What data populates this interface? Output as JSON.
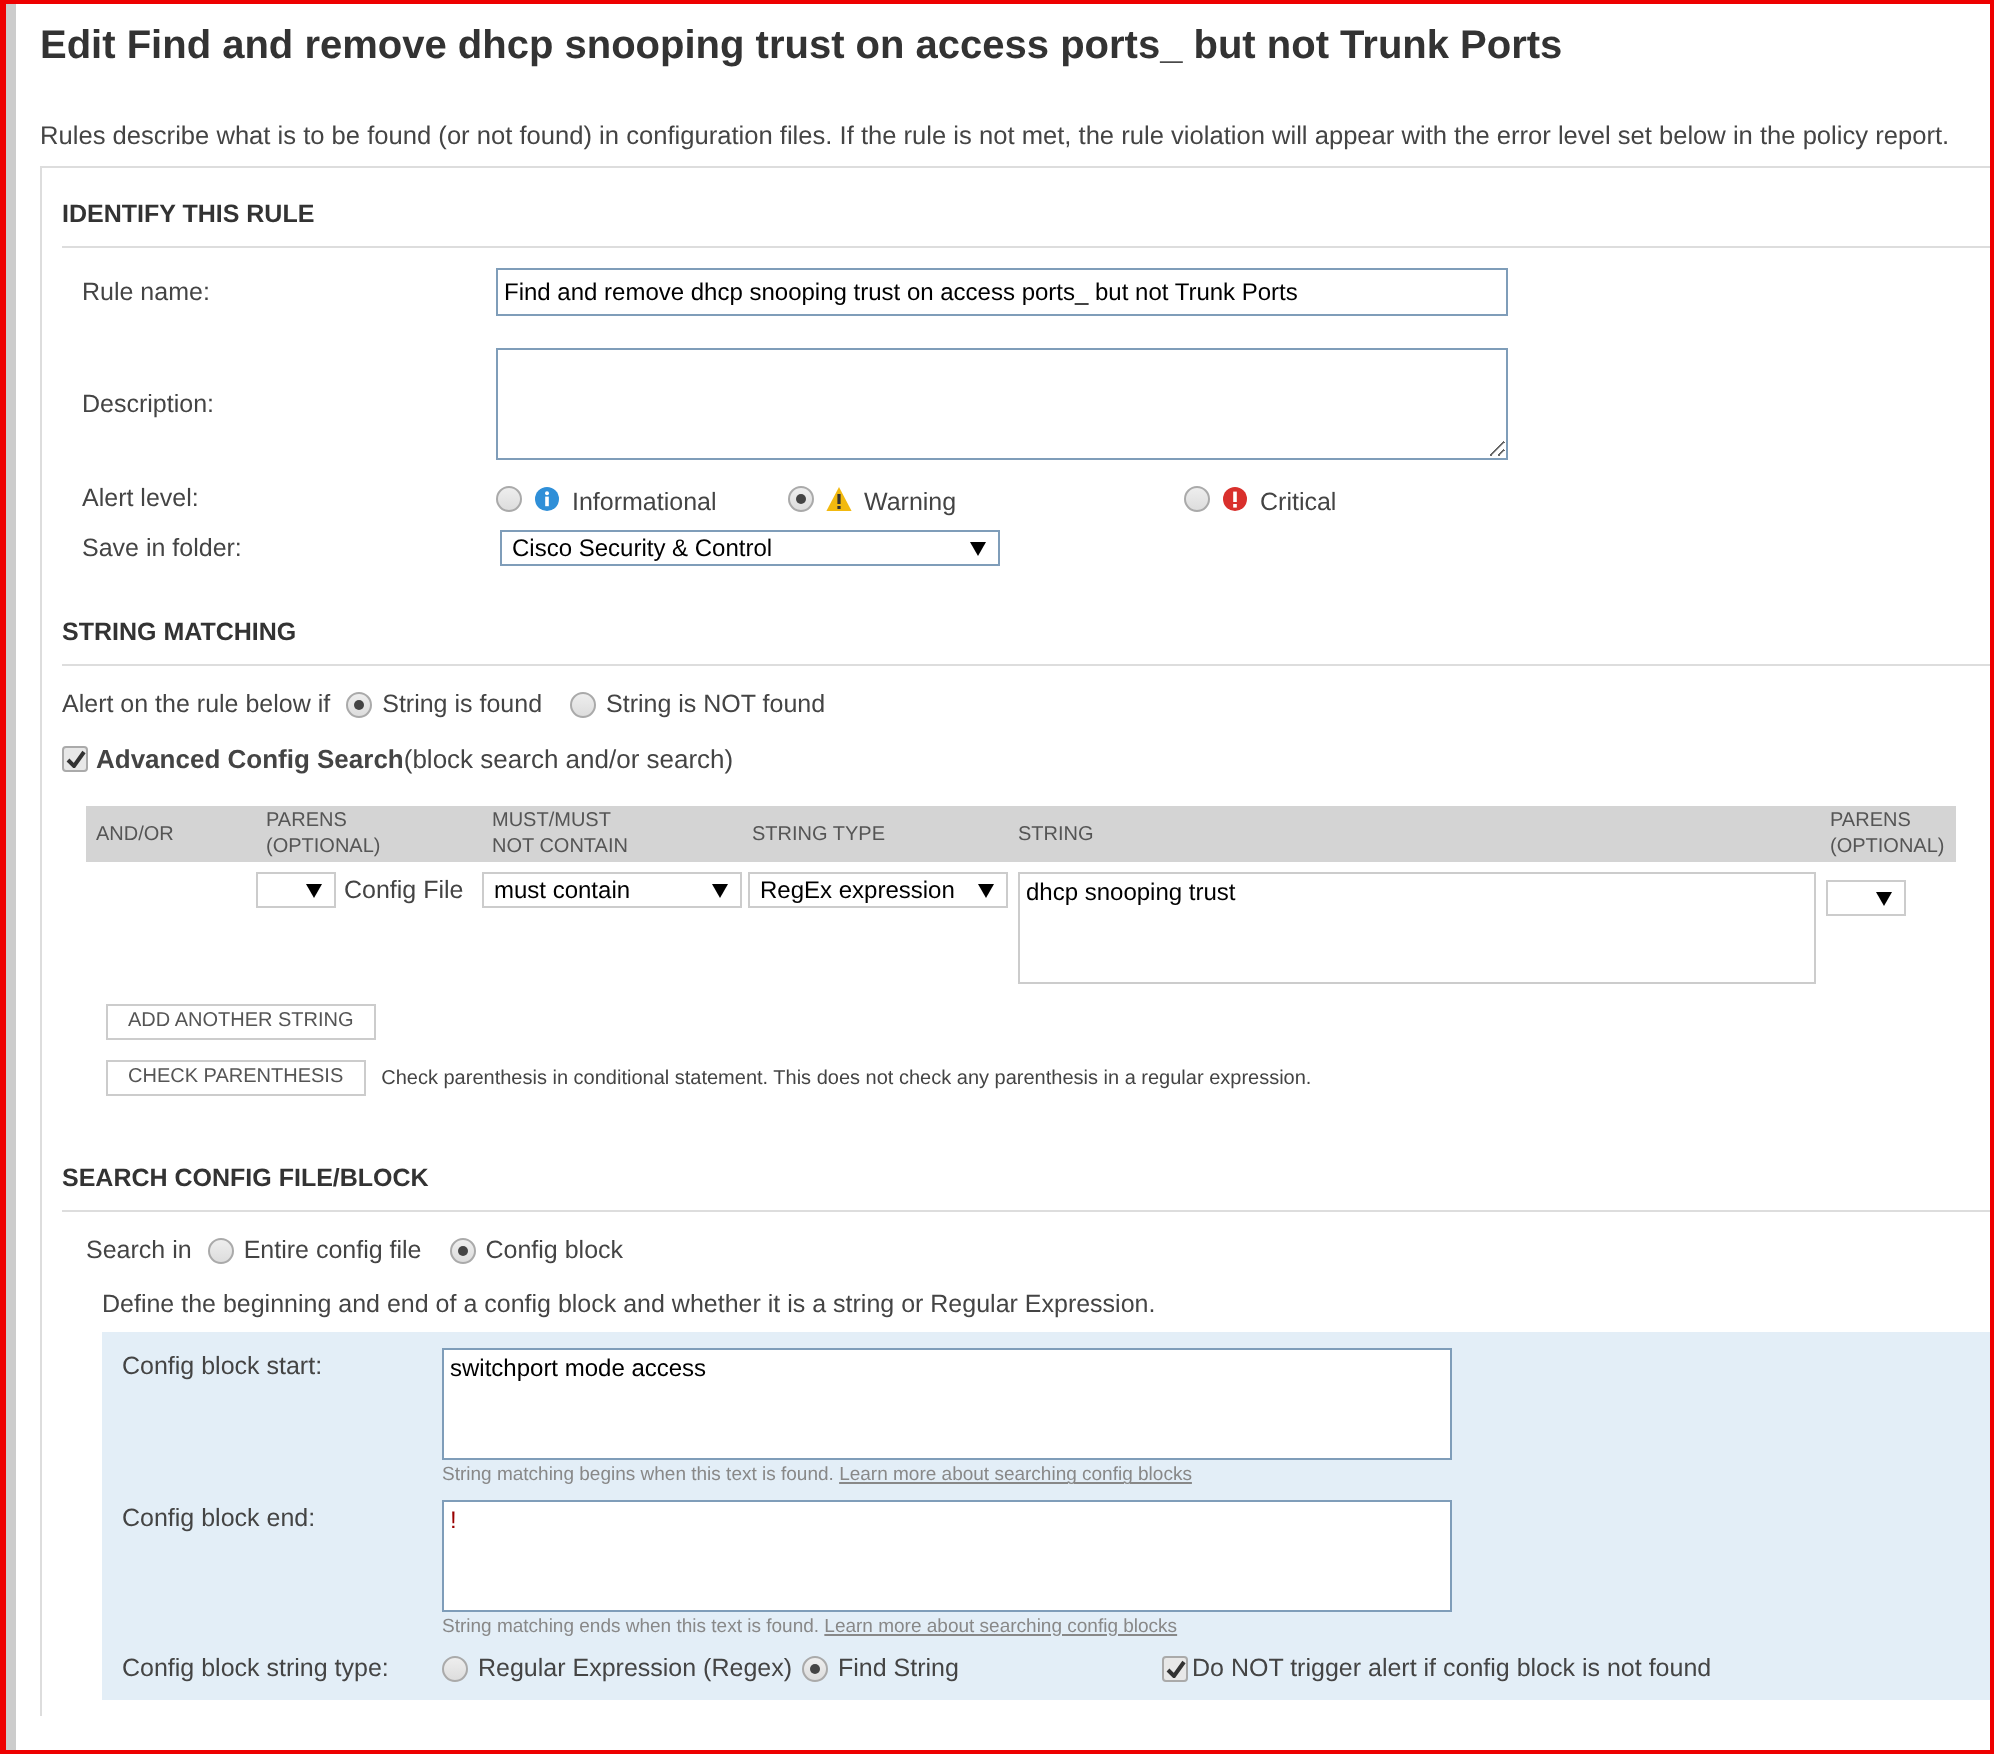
{
  "title": "Edit Find and remove dhcp snooping trust on access ports_ but not Trunk Ports",
  "intro": "Rules describe what is to be found (or not found) in configuration files. If the rule is not met, the rule violation will appear with the error level set below in the policy report.",
  "identify": {
    "heading": "IDENTIFY THIS RULE",
    "rule_name": {
      "label": "Rule name:",
      "value": "Find and remove dhcp snooping trust on access ports_ but not Trunk Ports"
    },
    "description": {
      "label": "Description:"
    },
    "alert_level": {
      "label": "Alert level:",
      "options": [
        {
          "label": "Informational",
          "kind": "info",
          "selected": false
        },
        {
          "label": "Warning",
          "kind": "warning",
          "selected": true
        },
        {
          "label": "Critical",
          "kind": "critical",
          "selected": false
        }
      ]
    },
    "folder": {
      "label": "Save in folder:",
      "value": "Cisco Security & Control"
    }
  },
  "string_matching": {
    "heading": "STRING MATCHING",
    "alert_on": {
      "label": "Alert on the rule below if",
      "options": [
        {
          "label": "String is found",
          "selected": true
        },
        {
          "label": "String is NOT found",
          "selected": false
        }
      ]
    },
    "advanced": {
      "checked": true,
      "label": "**Advanced Config Search**(block search and/or search)"
    },
    "table": {
      "columns": [
        "AND/OR",
        "PARENS (OPTIONAL)",
        "MUST/MUST NOT CONTAIN",
        "STRING TYPE",
        "STRING",
        "PARENS (OPTIONAL)"
      ],
      "rows": [
        {
          "source": "Config File",
          "must": "must contain",
          "string_type": "RegEx expression",
          "string": "dhcp snooping trust"
        }
      ]
    },
    "add_button": "ADD ANOTHER STRING",
    "check_button": "CHECK PARENTHESIS",
    "check_note": "Check parenthesis in conditional statement. This does not check any parenthesis in a regular expression."
  },
  "search_config": {
    "heading": "SEARCH CONFIG FILE/BLOCK",
    "search_in": {
      "label": "Search in",
      "options": [
        {
          "label": "Entire config file",
          "selected": false
        },
        {
          "label": "Config block",
          "selected": true
        }
      ]
    },
    "define_note": "Define the beginning and end of a config block and whether it is a string or Regular Expression.",
    "block_start": {
      "label": "Config block start:",
      "value": "switchport mode access",
      "hint": "String matching begins when this text is found.",
      "link": "Learn more about searching config blocks"
    },
    "block_end": {
      "label": "Config block end:",
      "value": "!",
      "hint": "String matching ends when this text is found.",
      "link": "Learn more about searching config blocks"
    },
    "string_type": {
      "label": "Config block string type:",
      "options": [
        {
          "label": "Regular Expression (Regex)",
          "selected": false
        },
        {
          "label": "Find String",
          "selected": true
        }
      ]
    },
    "no_alert": {
      "checked": true,
      "label": "Do NOT trigger alert if config block is not found"
    }
  }
}
